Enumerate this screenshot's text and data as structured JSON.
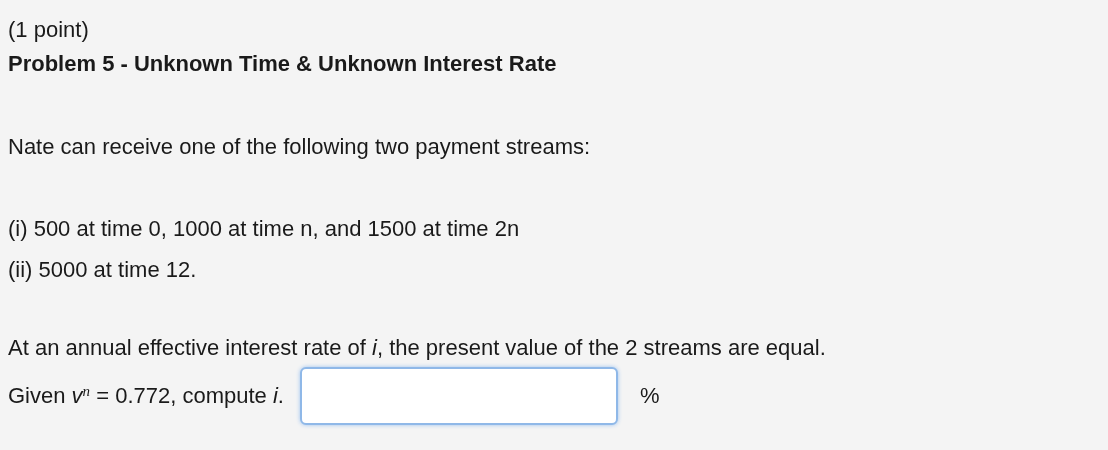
{
  "points": "(1 point)",
  "title": "Problem 5 - Unknown Time & Unknown Interest Rate",
  "intro": "Nate can receive one of the following two payment streams:",
  "streams": [
    "(i) 500 at time 0, 1000 at time n, and 1500 at time 2n",
    "(ii) 5000 at time 12."
  ],
  "statement": "At an annual effective interest rate of *i*, the present value of the 2 streams are equal.",
  "question": "Given *v*$^{n}$ = 0.772, compute *i*.",
  "answer": {
    "unit": "%"
  }
}
